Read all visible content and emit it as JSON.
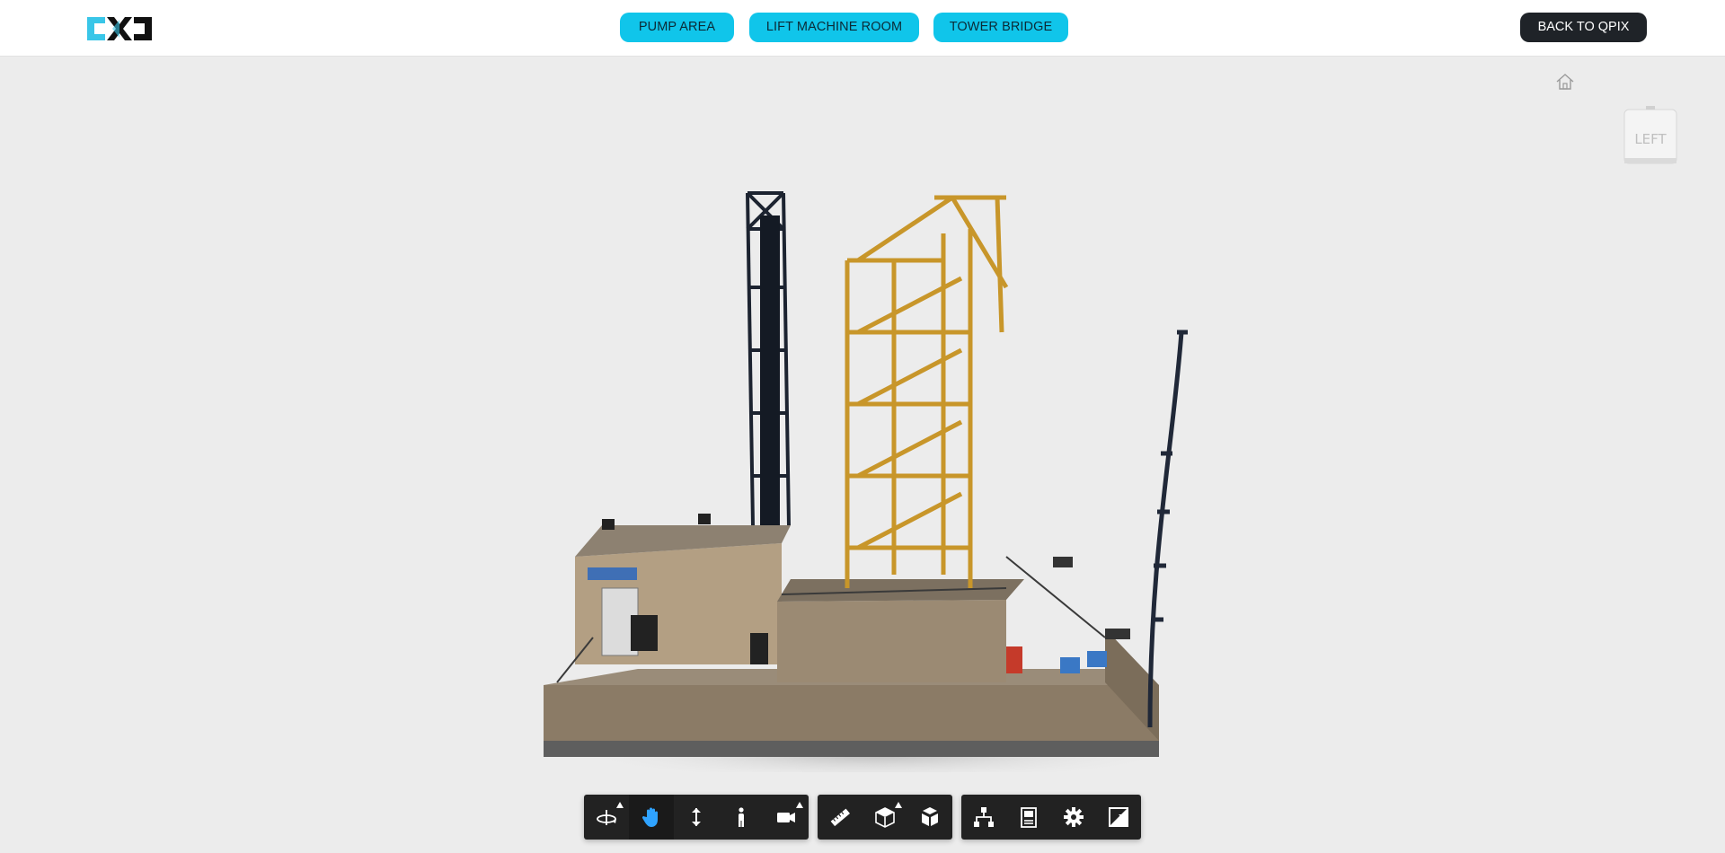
{
  "header": {
    "logo_name": "cxd-logo",
    "nav": [
      {
        "label": "PUMP AREA"
      },
      {
        "label": "LIFT MACHINE ROOM"
      },
      {
        "label": "TOWER BRIDGE"
      }
    ],
    "back_label": "BACK TO QPIX"
  },
  "viewer": {
    "view_cube_label": "LEFT",
    "home_icon": "home-icon"
  },
  "toolbar": {
    "groups": [
      {
        "tools": [
          "orbit-icon",
          "pan-icon",
          "zoom-icon",
          "first-person-icon",
          "camera-icon"
        ]
      },
      {
        "tools": [
          "measure-icon",
          "section-icon",
          "explode-icon"
        ]
      },
      {
        "tools": [
          "model-browser-icon",
          "properties-icon",
          "settings-icon",
          "fullscreen-icon"
        ]
      }
    ],
    "active_tool": "pan-icon"
  },
  "colors": {
    "accent": "#10c5ea",
    "dark_button": "#1f2328",
    "toolbar_bg": "#222222",
    "active_icon": "#2fa3ff",
    "viewport_bg": "#ececec"
  }
}
